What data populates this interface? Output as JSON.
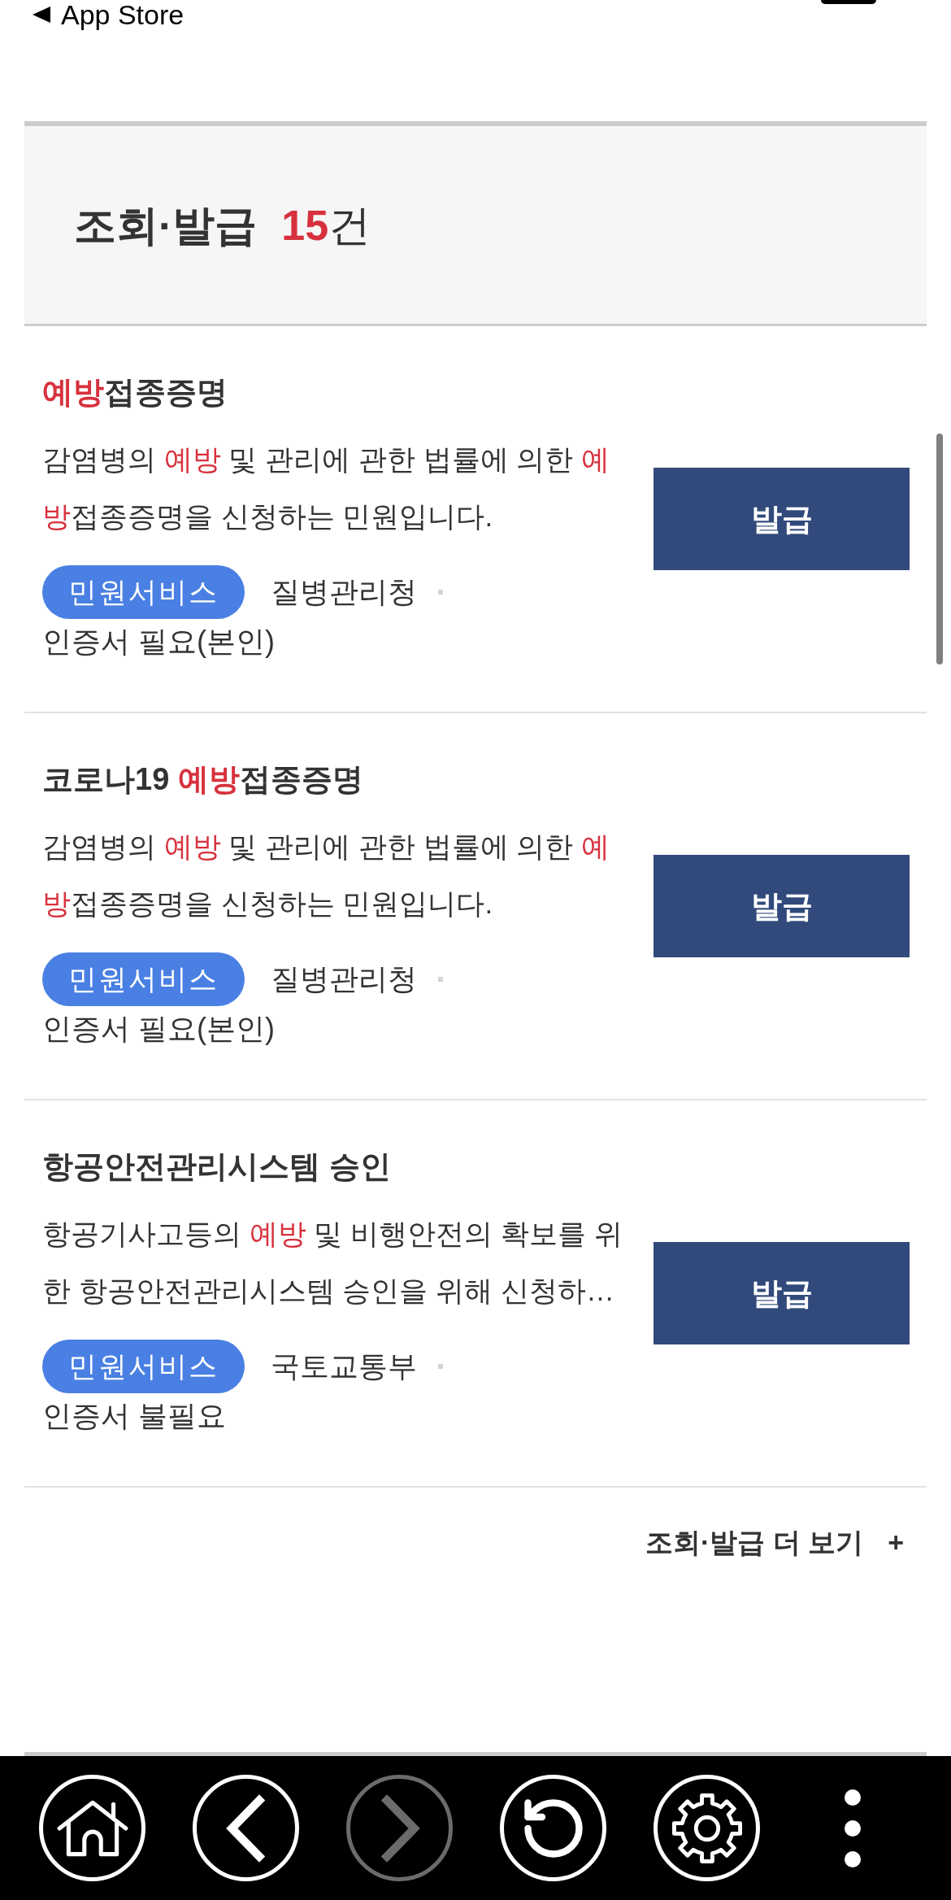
{
  "status_bar": {
    "back_label": "App Store"
  },
  "section": {
    "title": "조회·발급",
    "count": "15",
    "count_unit": "건"
  },
  "results": [
    {
      "title": [
        {
          "text": "예방",
          "highlight": true
        },
        {
          "text": "접종증명",
          "highlight": false
        }
      ],
      "description": [
        {
          "text": "감염병의 ",
          "highlight": false
        },
        {
          "text": "예방",
          "highlight": true
        },
        {
          "text": " 및 관리에 관한 법률에 의한 ",
          "highlight": false
        },
        {
          "text": "예방",
          "highlight": true
        },
        {
          "text": "접종증명을 신청하는 민원입니다.",
          "highlight": false
        }
      ],
      "category": "민원서비스",
      "agency": "질병관리청",
      "requirement": "인증서 필요(본인)",
      "action": "발급"
    },
    {
      "title": [
        {
          "text": "코로나19 ",
          "highlight": false
        },
        {
          "text": "예방",
          "highlight": true
        },
        {
          "text": "접종증명",
          "highlight": false
        }
      ],
      "description": [
        {
          "text": "감염병의 ",
          "highlight": false
        },
        {
          "text": "예방",
          "highlight": true
        },
        {
          "text": " 및 관리에 관한 법률에 의한 ",
          "highlight": false
        },
        {
          "text": "예방",
          "highlight": true
        },
        {
          "text": "접종증명을 신청하는 민원입니다.",
          "highlight": false
        }
      ],
      "category": "민원서비스",
      "agency": "질병관리청",
      "requirement": "인증서 필요(본인)",
      "action": "발급"
    },
    {
      "title": [
        {
          "text": "항공안전관리시스템 승인",
          "highlight": false
        }
      ],
      "description": [
        {
          "text": "항공기사고등의 ",
          "highlight": false
        },
        {
          "text": "예방",
          "highlight": true
        },
        {
          "text": " 및 비행안전의 확보를 위한 항공안전관리시스템 승인을 위해 신청하…",
          "highlight": false
        }
      ],
      "category": "민원서비스",
      "agency": "국토교통부",
      "requirement": "인증서 불필요",
      "action": "발급"
    }
  ],
  "more_link": {
    "label": "조회·발급 더 보기",
    "plus": "+"
  },
  "toolbar": [
    {
      "kind": "home",
      "disabled": false
    },
    {
      "kind": "back",
      "disabled": false
    },
    {
      "kind": "forward",
      "disabled": true
    },
    {
      "kind": "reload",
      "disabled": false
    },
    {
      "kind": "settings",
      "disabled": false
    },
    {
      "kind": "more",
      "disabled": false
    }
  ]
}
